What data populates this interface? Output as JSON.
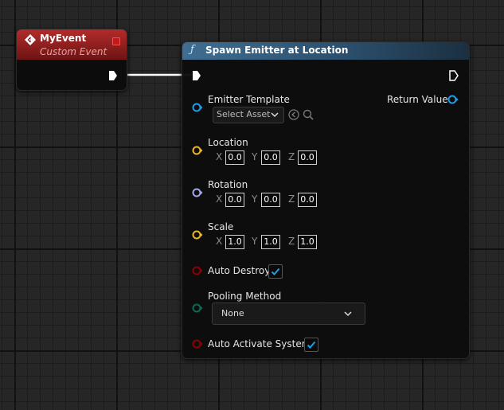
{
  "event_node": {
    "title": "MyEvent",
    "subtitle": "Custom Event",
    "icon": "event-diamond-icon",
    "color": "#b32b2b"
  },
  "function_node": {
    "title": "Spawn Emitter at Location",
    "icon_glyph": "ƒ",
    "icon": "function-icon",
    "return_value_label": "Return Value",
    "emitter_template": {
      "label": "Emitter Template",
      "select_label": "Select Asset",
      "browse_icon": "arrow-left-circle-icon",
      "search_icon": "search-icon"
    },
    "location": {
      "label": "Location",
      "x": "0.0",
      "y": "0.0",
      "z": "0.0"
    },
    "rotation": {
      "label": "Rotation",
      "x": "0.0",
      "y": "0.0",
      "z": "0.0"
    },
    "scale": {
      "label": "Scale",
      "x": "1.0",
      "y": "1.0",
      "z": "1.0"
    },
    "axis_labels": {
      "x": "X",
      "y": "Y",
      "z": "Z"
    },
    "auto_destroy": {
      "label": "Auto Destroy",
      "checked": true
    },
    "pooling_method": {
      "label": "Pooling Method",
      "value": "None"
    },
    "auto_activate": {
      "label": "Auto Activate System",
      "checked": true
    }
  },
  "pin_colors": {
    "exec": "#ffffff",
    "object": "#1e9ee8",
    "vector": "#e8b72c",
    "rotator": "#a0a9e6",
    "bool": "#8f0000",
    "enum": "#0a6a5a"
  }
}
